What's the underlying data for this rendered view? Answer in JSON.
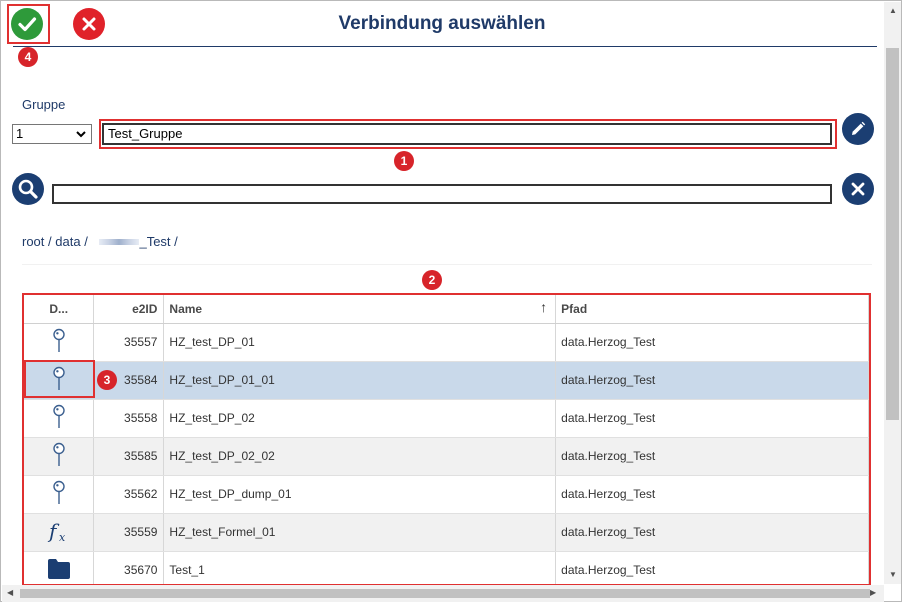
{
  "dialog": {
    "title": "Verbindung auswählen"
  },
  "group": {
    "label": "Gruppe",
    "selected": "1",
    "name_value": "Test_Gruppe"
  },
  "search": {
    "value": ""
  },
  "breadcrumb": {
    "root": "root",
    "data": "data",
    "tail": "_Test",
    "sep": "/"
  },
  "badges": {
    "b1": "1",
    "b2": "2",
    "b3": "3",
    "b4": "4"
  },
  "table": {
    "columns": [
      "D...",
      "e2ID",
      "Name",
      "Pfad"
    ],
    "sort_indicator": "↑",
    "rows": [
      {
        "icon": "pin-icon",
        "id": "35557",
        "name": "HZ_test_DP_01",
        "path": "data.Herzog_Test"
      },
      {
        "icon": "pin-icon",
        "id": "35584",
        "name": "HZ_test_DP_01_01",
        "path": "data.Herzog_Test"
      },
      {
        "icon": "pin-icon",
        "id": "35558",
        "name": "HZ_test_DP_02",
        "path": "data.Herzog_Test"
      },
      {
        "icon": "pin-icon",
        "id": "35585",
        "name": "HZ_test_DP_02_02",
        "path": "data.Herzog_Test"
      },
      {
        "icon": "pin-icon",
        "id": "35562",
        "name": "HZ_test_DP_dump_01",
        "path": "data.Herzog_Test"
      },
      {
        "icon": "formula-icon",
        "id": "35559",
        "name": "HZ_test_Formel_01",
        "path": "data.Herzog_Test"
      },
      {
        "icon": "folder-icon",
        "id": "35670",
        "name": "Test_1",
        "path": "data.Herzog_Test"
      }
    ],
    "selected_row": 1
  },
  "colors": {
    "accent": "#1f3a68",
    "confirm": "#2e9a3a",
    "cancel": "#e0222a",
    "annotation": "#e03030",
    "selection": "#c9d9ea"
  }
}
